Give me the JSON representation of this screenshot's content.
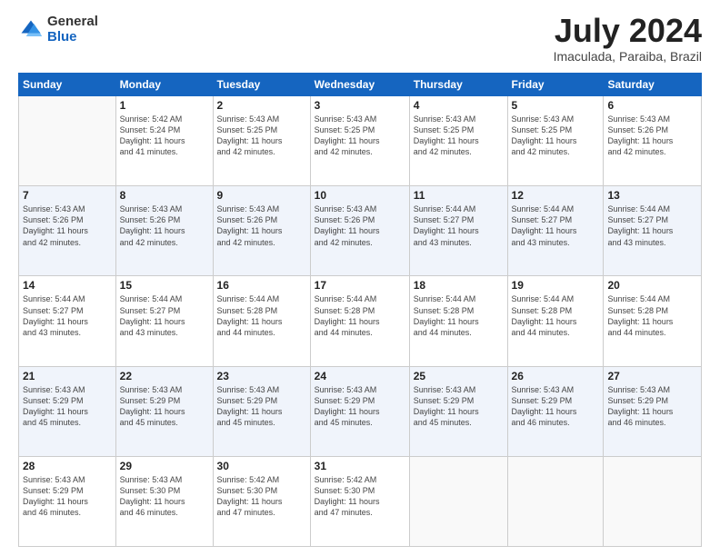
{
  "logo": {
    "general": "General",
    "blue": "Blue"
  },
  "title": "July 2024",
  "location": "Imaculada, Paraiba, Brazil",
  "headers": [
    "Sunday",
    "Monday",
    "Tuesday",
    "Wednesday",
    "Thursday",
    "Friday",
    "Saturday"
  ],
  "weeks": [
    [
      {
        "day": "",
        "info": ""
      },
      {
        "day": "1",
        "info": "Sunrise: 5:42 AM\nSunset: 5:24 PM\nDaylight: 11 hours\nand 41 minutes."
      },
      {
        "day": "2",
        "info": "Sunrise: 5:43 AM\nSunset: 5:25 PM\nDaylight: 11 hours\nand 42 minutes."
      },
      {
        "day": "3",
        "info": "Sunrise: 5:43 AM\nSunset: 5:25 PM\nDaylight: 11 hours\nand 42 minutes."
      },
      {
        "day": "4",
        "info": "Sunrise: 5:43 AM\nSunset: 5:25 PM\nDaylight: 11 hours\nand 42 minutes."
      },
      {
        "day": "5",
        "info": "Sunrise: 5:43 AM\nSunset: 5:25 PM\nDaylight: 11 hours\nand 42 minutes."
      },
      {
        "day": "6",
        "info": "Sunrise: 5:43 AM\nSunset: 5:26 PM\nDaylight: 11 hours\nand 42 minutes."
      }
    ],
    [
      {
        "day": "7",
        "info": "Sunrise: 5:43 AM\nSunset: 5:26 PM\nDaylight: 11 hours\nand 42 minutes."
      },
      {
        "day": "8",
        "info": "Sunrise: 5:43 AM\nSunset: 5:26 PM\nDaylight: 11 hours\nand 42 minutes."
      },
      {
        "day": "9",
        "info": "Sunrise: 5:43 AM\nSunset: 5:26 PM\nDaylight: 11 hours\nand 42 minutes."
      },
      {
        "day": "10",
        "info": "Sunrise: 5:43 AM\nSunset: 5:26 PM\nDaylight: 11 hours\nand 42 minutes."
      },
      {
        "day": "11",
        "info": "Sunrise: 5:44 AM\nSunset: 5:27 PM\nDaylight: 11 hours\nand 43 minutes."
      },
      {
        "day": "12",
        "info": "Sunrise: 5:44 AM\nSunset: 5:27 PM\nDaylight: 11 hours\nand 43 minutes."
      },
      {
        "day": "13",
        "info": "Sunrise: 5:44 AM\nSunset: 5:27 PM\nDaylight: 11 hours\nand 43 minutes."
      }
    ],
    [
      {
        "day": "14",
        "info": "Sunrise: 5:44 AM\nSunset: 5:27 PM\nDaylight: 11 hours\nand 43 minutes."
      },
      {
        "day": "15",
        "info": "Sunrise: 5:44 AM\nSunset: 5:27 PM\nDaylight: 11 hours\nand 43 minutes."
      },
      {
        "day": "16",
        "info": "Sunrise: 5:44 AM\nSunset: 5:28 PM\nDaylight: 11 hours\nand 44 minutes."
      },
      {
        "day": "17",
        "info": "Sunrise: 5:44 AM\nSunset: 5:28 PM\nDaylight: 11 hours\nand 44 minutes."
      },
      {
        "day": "18",
        "info": "Sunrise: 5:44 AM\nSunset: 5:28 PM\nDaylight: 11 hours\nand 44 minutes."
      },
      {
        "day": "19",
        "info": "Sunrise: 5:44 AM\nSunset: 5:28 PM\nDaylight: 11 hours\nand 44 minutes."
      },
      {
        "day": "20",
        "info": "Sunrise: 5:44 AM\nSunset: 5:28 PM\nDaylight: 11 hours\nand 44 minutes."
      }
    ],
    [
      {
        "day": "21",
        "info": "Sunrise: 5:43 AM\nSunset: 5:29 PM\nDaylight: 11 hours\nand 45 minutes."
      },
      {
        "day": "22",
        "info": "Sunrise: 5:43 AM\nSunset: 5:29 PM\nDaylight: 11 hours\nand 45 minutes."
      },
      {
        "day": "23",
        "info": "Sunrise: 5:43 AM\nSunset: 5:29 PM\nDaylight: 11 hours\nand 45 minutes."
      },
      {
        "day": "24",
        "info": "Sunrise: 5:43 AM\nSunset: 5:29 PM\nDaylight: 11 hours\nand 45 minutes."
      },
      {
        "day": "25",
        "info": "Sunrise: 5:43 AM\nSunset: 5:29 PM\nDaylight: 11 hours\nand 45 minutes."
      },
      {
        "day": "26",
        "info": "Sunrise: 5:43 AM\nSunset: 5:29 PM\nDaylight: 11 hours\nand 46 minutes."
      },
      {
        "day": "27",
        "info": "Sunrise: 5:43 AM\nSunset: 5:29 PM\nDaylight: 11 hours\nand 46 minutes."
      }
    ],
    [
      {
        "day": "28",
        "info": "Sunrise: 5:43 AM\nSunset: 5:29 PM\nDaylight: 11 hours\nand 46 minutes."
      },
      {
        "day": "29",
        "info": "Sunrise: 5:43 AM\nSunset: 5:30 PM\nDaylight: 11 hours\nand 46 minutes."
      },
      {
        "day": "30",
        "info": "Sunrise: 5:42 AM\nSunset: 5:30 PM\nDaylight: 11 hours\nand 47 minutes."
      },
      {
        "day": "31",
        "info": "Sunrise: 5:42 AM\nSunset: 5:30 PM\nDaylight: 11 hours\nand 47 minutes."
      },
      {
        "day": "",
        "info": ""
      },
      {
        "day": "",
        "info": ""
      },
      {
        "day": "",
        "info": ""
      }
    ]
  ]
}
